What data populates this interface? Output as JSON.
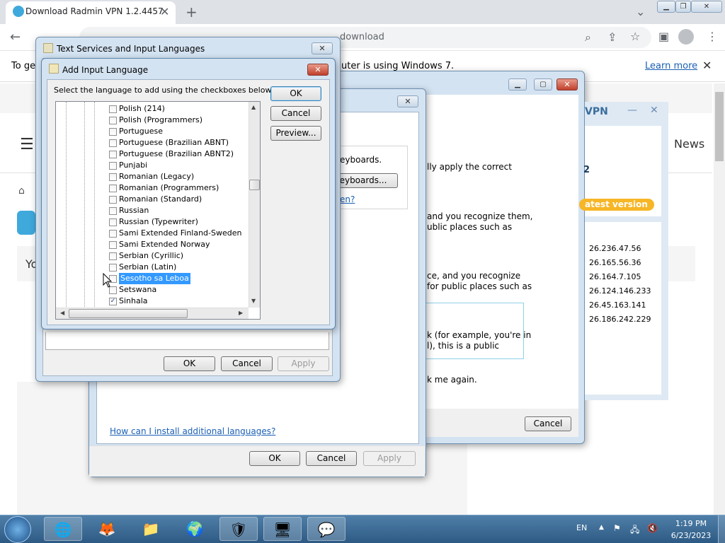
{
  "browser": {
    "tab_title": "Download Radmin VPN 1.2.4457",
    "url_visible": "download",
    "info_text_left": "To get",
    "info_text_right": "uter is using Windows 7.",
    "learn_more": "Learn more"
  },
  "page": {
    "news": "News",
    "vpn_label": "VPN",
    "version_fragment": "2",
    "latest_version": "atest version",
    "ips": [
      "26.236.47.56",
      "26.165.56.36",
      "26.164.7.105",
      "26.124.146.233",
      "26.45.163.141",
      "26.186.242.229"
    ],
    "yo_fragment": "Yo"
  },
  "network_dialog": {
    "text1": "lly apply the correct",
    "text2": "and you recognize them,",
    "text3": "ublic places such as",
    "text4": "ce, and you recognize",
    "text5": "for public places such as",
    "text6": "k (for example, you're in",
    "text7": "l), this is a public",
    "text8": "k me again.",
    "cancel": "Cancel"
  },
  "regional_dialog": {
    "keyboards_text": "eyboards.",
    "keyboards_btn": "eyboards...",
    "link_frag": "en?",
    "install_link": "How can I install additional languages?",
    "ok": "OK",
    "cancel": "Cancel",
    "apply": "Apply"
  },
  "text_services": {
    "title": "Text Services and Input Languages",
    "ok": "OK",
    "cancel": "Cancel",
    "apply": "Apply"
  },
  "add_lang": {
    "title": "Add Input Language",
    "instruction": "Select the language to add using the checkboxes below.",
    "ok": "OK",
    "cancel": "Cancel",
    "preview": "Preview...",
    "items": [
      {
        "label": "Polish (214)",
        "checked": false
      },
      {
        "label": "Polish (Programmers)",
        "checked": false
      },
      {
        "label": "Portuguese",
        "checked": false
      },
      {
        "label": "Portuguese (Brazilian ABNT)",
        "checked": false
      },
      {
        "label": "Portuguese (Brazilian ABNT2)",
        "checked": false
      },
      {
        "label": "Punjabi",
        "checked": false
      },
      {
        "label": "Romanian (Legacy)",
        "checked": false
      },
      {
        "label": "Romanian (Programmers)",
        "checked": false
      },
      {
        "label": "Romanian (Standard)",
        "checked": false
      },
      {
        "label": "Russian",
        "checked": false
      },
      {
        "label": "Russian (Typewriter)",
        "checked": false
      },
      {
        "label": "Sami Extended Finland-Sweden",
        "checked": false
      },
      {
        "label": "Sami Extended Norway",
        "checked": false
      },
      {
        "label": "Serbian (Cyrillic)",
        "checked": false
      },
      {
        "label": "Serbian (Latin)",
        "checked": false
      },
      {
        "label": "Sesotho sa Leboa",
        "checked": false,
        "selected": true
      },
      {
        "label": "Setswana",
        "checked": false
      },
      {
        "label": "Sinhala",
        "checked": true
      }
    ]
  },
  "taskbar": {
    "lang": "EN",
    "time": "1:19 PM",
    "date": "6/23/2023"
  },
  "colors": {
    "accent": "#3399ff",
    "badge": "#f6b626",
    "taskbar": "#2d5a84"
  }
}
